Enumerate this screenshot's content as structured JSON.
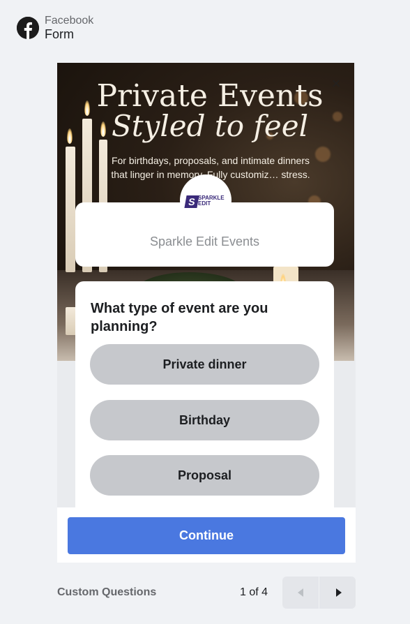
{
  "header": {
    "app": "Facebook",
    "subtitle": "Form"
  },
  "hero": {
    "title_line1": "Private Events",
    "title_line2": "Styled to feel",
    "subtitle": "For birthdays, proposals, and intimate dinners that linger in memory. Fully customiz… stress."
  },
  "brand": {
    "name": "Sparkle Edit Events",
    "logo_letter": "S",
    "logo_text_1": "SPARKLE",
    "logo_text_2": "EDIT"
  },
  "form": {
    "question": "What type of event are you planning?",
    "options": [
      "Private dinner",
      "Birthday",
      "Proposal"
    ],
    "continue_label": "Continue"
  },
  "footer": {
    "section": "Custom Questions",
    "pagination": "1 of 4"
  },
  "colors": {
    "continue": "#4a78e0",
    "option": "#c6c8cc"
  }
}
